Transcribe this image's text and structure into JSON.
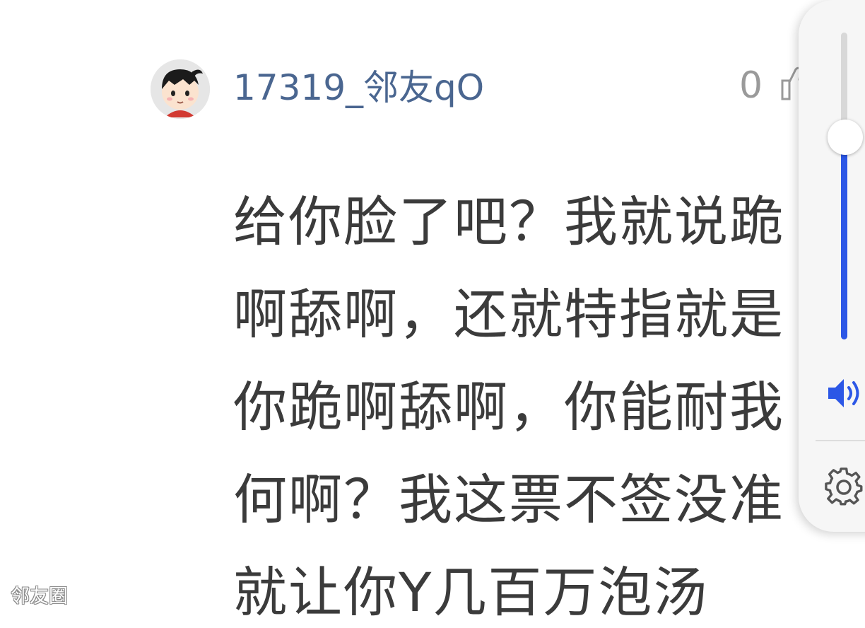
{
  "comment": {
    "username": "17319_邻友qO",
    "like_count": "0",
    "text_lines": [
      "给你脸了吧？我就说跪",
      "啊舔啊，还就特指就是",
      "你跪啊舔啊，你能耐我",
      "何啊？我这票不签没准",
      "就让你Y几百万泡汤"
    ]
  },
  "watermark": "邻友圈",
  "volume_panel": {
    "level": 0.66,
    "accent_color": "#2c57e6",
    "icons": [
      "speaker-icon",
      "gear-icon"
    ]
  }
}
